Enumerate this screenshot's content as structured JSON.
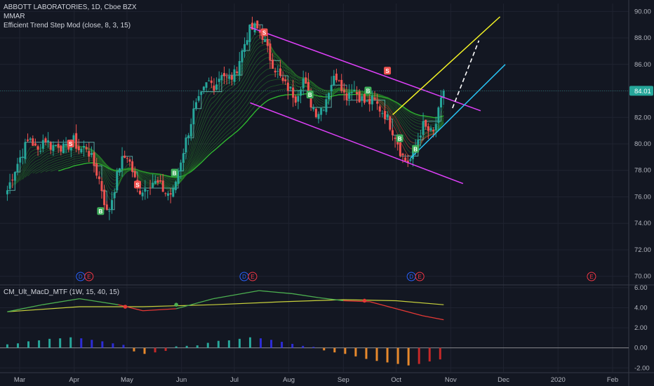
{
  "header": {
    "title": "ABBOTT LABORATORIES, 1D, Cboe BZX",
    "study1": "MMAR",
    "study2": "Efficient Trend Step Mod (close, 8, 3, 15)"
  },
  "macd_panel": {
    "title": "CM_Ult_MacD_MTF (1W, 15, 40, 15)"
  },
  "colors": {
    "background": "#131722",
    "grid": "#1f2330",
    "axis_text": "#b2b5be",
    "bull": "#26a69a",
    "bear": "#ef5350",
    "channel": "#e040fb",
    "yellow_line": "#f5f525",
    "cyan_line": "#29c5f6",
    "dashed_line": "#ffffff",
    "price_badge": "#26a69a",
    "macd_green": "#4caf50",
    "macd_red": "#e53935",
    "macd_yellow": "#c8d13c",
    "hist_teal": "#26a69a",
    "hist_blue": "#2c2cd8",
    "hist_orange": "#e8892c",
    "hist_red": "#c62828"
  },
  "chart_data": [
    {
      "type": "candlestick",
      "title": "ABBOTT LABORATORIES, 1D, Cboe BZX",
      "x_axis": {
        "labels": [
          "Mar",
          "Apr",
          "May",
          "Jun",
          "Jul",
          "Aug",
          "Sep",
          "Oct",
          "Nov",
          "Dec",
          "2020",
          "Feb"
        ],
        "label_days": [
          0,
          31,
          61,
          92,
          122,
          153,
          184,
          214,
          245,
          275,
          306,
          337
        ]
      },
      "y_axis": {
        "ticks": [
          "90.00",
          "88.00",
          "86.00",
          "84.00",
          "82.00",
          "80.00",
          "78.00",
          "76.00",
          "74.00",
          "72.00",
          "70.00"
        ],
        "range": [
          69.4,
          90.6
        ]
      },
      "last_price": "84.01",
      "anchors": [
        [
          -7,
          76.5
        ],
        [
          -3,
          78.0
        ],
        [
          2,
          79.5
        ],
        [
          6,
          80.5
        ],
        [
          10,
          79.3
        ],
        [
          14,
          80.5
        ],
        [
          18,
          79.8
        ],
        [
          22,
          80.0
        ],
        [
          26,
          79.5
        ],
        [
          30,
          80.4
        ],
        [
          34,
          79.5
        ],
        [
          38,
          79.8
        ],
        [
          42,
          78.5
        ],
        [
          46,
          77.0
        ],
        [
          50,
          74.5
        ],
        [
          53,
          76.2
        ],
        [
          57,
          78.5
        ],
        [
          61,
          79.2
        ],
        [
          64,
          78.0
        ],
        [
          67,
          76.5
        ],
        [
          71,
          76.6
        ],
        [
          75,
          77.2
        ],
        [
          79,
          76.9
        ],
        [
          83,
          76.3
        ],
        [
          87,
          76.2
        ],
        [
          91,
          78.5
        ],
        [
          95,
          80.5
        ],
        [
          99,
          82.5
        ],
        [
          103,
          83.5
        ],
        [
          107,
          84.7
        ],
        [
          111,
          84.4
        ],
        [
          115,
          85.5
        ],
        [
          118,
          84.8
        ],
        [
          122,
          85.2
        ],
        [
          126,
          86.8
        ],
        [
          130,
          88.5
        ],
        [
          134,
          88.8
        ],
        [
          138,
          88.2
        ],
        [
          142,
          86.6
        ],
        [
          146,
          85.5
        ],
        [
          150,
          84.5
        ],
        [
          153,
          84.2
        ],
        [
          157,
          83.5
        ],
        [
          161,
          85.0
        ],
        [
          165,
          83.2
        ],
        [
          169,
          82.3
        ],
        [
          173,
          83.0
        ],
        [
          177,
          84.6
        ],
        [
          181,
          85.3
        ],
        [
          185,
          83.5
        ],
        [
          189,
          84.3
        ],
        [
          193,
          83.6
        ],
        [
          197,
          83.0
        ],
        [
          201,
          83.3
        ],
        [
          205,
          82.6
        ],
        [
          208,
          82.2
        ],
        [
          211,
          81.3
        ],
        [
          214,
          80.5
        ],
        [
          217,
          79.2
        ],
        [
          220,
          78.6
        ],
        [
          223,
          78.9
        ],
        [
          226,
          80.2
        ],
        [
          229,
          81.4
        ],
        [
          232,
          81.0
        ],
        [
          235,
          80.7
        ],
        [
          238,
          82.3
        ],
        [
          241,
          84.0
        ]
      ],
      "annotations": {
        "dividends_earnings": [
          {
            "day": 37,
            "labels": [
              "D",
              "E"
            ]
          },
          {
            "day": 130,
            "labels": [
              "D",
              "E"
            ]
          },
          {
            "day": 225,
            "labels": [
              "D",
              "E"
            ]
          },
          {
            "day": 325,
            "labels": [
              "E"
            ]
          }
        ],
        "buy_signals": [
          {
            "day": 46,
            "value": 74.9,
            "label": "B"
          },
          {
            "day": 88,
            "value": 77.8,
            "label": "B"
          },
          {
            "day": 165,
            "value": 83.7,
            "label": "B"
          },
          {
            "day": 198,
            "value": 84.0,
            "label": "B"
          },
          {
            "day": 216,
            "value": 80.4,
            "label": "B"
          },
          {
            "day": 225,
            "value": 79.6,
            "label": "B"
          }
        ],
        "sell_signals": [
          {
            "day": 29,
            "value": 80.0,
            "label": "S"
          },
          {
            "day": 67,
            "value": 76.9,
            "label": "S"
          },
          {
            "day": 139,
            "value": 88.4,
            "label": "S"
          },
          {
            "day": 209,
            "value": 85.5,
            "label": "S"
          }
        ],
        "trendlines": [
          {
            "name": "channel_upper",
            "from": [
              131,
              88.8
            ],
            "to": [
              262,
              82.5
            ]
          },
          {
            "name": "channel_lower",
            "from": [
              131,
              83.1
            ],
            "to": [
              252,
              77.0
            ]
          },
          {
            "name": "yellow",
            "from": [
              212,
              82.2
            ],
            "to": [
              273,
              89.6
            ]
          },
          {
            "name": "cyan",
            "from": [
              222,
              78.9
            ],
            "to": [
              276,
              86.0
            ]
          },
          {
            "name": "white_dashed",
            "from": [
              246,
              82.7
            ],
            "to": [
              261,
              87.8
            ]
          }
        ]
      }
    },
    {
      "type": "macd",
      "title": "CM_Ult_MacD_MTF (1W, 15, 40, 15)",
      "y_axis": {
        "ticks": [
          "6.00",
          "4.00",
          "2.00",
          "0.00",
          "-2.00"
        ],
        "range": [
          -2.4,
          6.2
        ]
      },
      "macd_line_x": [
        -7,
        13,
        34,
        56,
        70,
        89,
        110,
        136,
        155,
        170,
        184,
        199,
        214,
        229,
        241
      ],
      "macd_line_y": [
        3.6,
        4.3,
        4.9,
        4.3,
        3.7,
        3.9,
        4.9,
        5.7,
        5.4,
        5.0,
        4.7,
        4.6,
        3.9,
        3.2,
        2.8
      ],
      "signal_line_x": [
        -7,
        34,
        70,
        110,
        150,
        184,
        214,
        241
      ],
      "signal_line_y": [
        3.6,
        4.1,
        4.1,
        4.3,
        4.6,
        4.8,
        4.7,
        4.3
      ],
      "crosses": [
        {
          "day": 60,
          "value": 4.1,
          "type": "bearish"
        },
        {
          "day": 89,
          "value": 4.3,
          "type": "bullish"
        },
        {
          "day": 196,
          "value": 4.7,
          "type": "bearish"
        }
      ],
      "histogram_x": [
        -7,
        -1,
        5,
        11,
        17,
        23,
        29,
        35,
        41,
        47,
        53,
        59,
        65,
        71,
        77,
        83,
        89,
        95,
        101,
        107,
        113,
        119,
        125,
        131,
        137,
        143,
        149,
        155,
        161,
        167,
        173,
        179,
        185,
        191,
        197,
        203,
        209,
        215,
        221,
        227,
        233,
        239
      ],
      "histogram_values": [
        0.35,
        0.45,
        0.65,
        0.75,
        0.9,
        0.95,
        1.05,
        0.95,
        0.8,
        0.65,
        0.45,
        0.3,
        -0.35,
        -0.6,
        -0.45,
        -0.3,
        0.15,
        0.2,
        0.25,
        0.5,
        0.7,
        0.75,
        0.9,
        1.05,
        0.95,
        0.8,
        0.6,
        0.4,
        0.2,
        0.1,
        -0.25,
        -0.45,
        -0.6,
        -0.85,
        -1.1,
        -1.3,
        -1.45,
        -1.6,
        -1.75,
        -1.6,
        -1.35,
        -1.15
      ]
    }
  ]
}
